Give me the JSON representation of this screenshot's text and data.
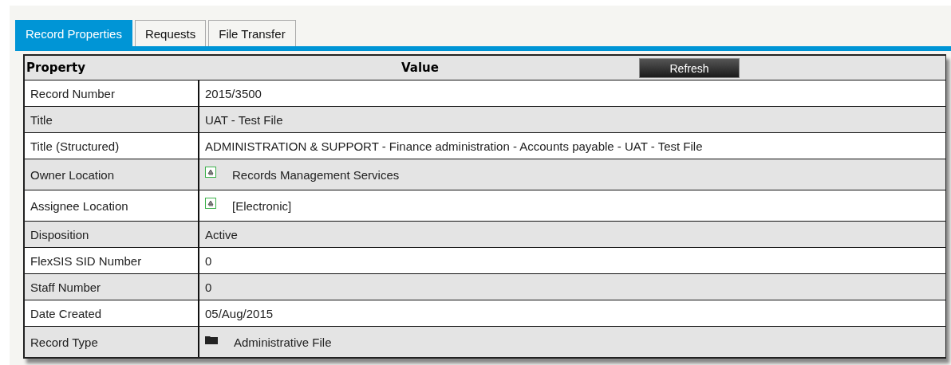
{
  "tabs": [
    {
      "label": "Record Properties",
      "selected": true
    },
    {
      "label": "Requests",
      "selected": false
    },
    {
      "label": "File Transfer",
      "selected": false
    }
  ],
  "table": {
    "columns": [
      "Property",
      "Value"
    ],
    "refresh_button": "Refresh",
    "rows": [
      {
        "property": "Record Number",
        "value": "2015/3500"
      },
      {
        "property": "Title",
        "value": "UAT - Test File"
      },
      {
        "property": "Title (Structured)",
        "value": "ADMINISTRATION & SUPPORT - Finance administration - Accounts payable - UAT - Test File"
      },
      {
        "property": "Owner Location",
        "value": "Records Management Services",
        "kind": "location"
      },
      {
        "property": "Assignee Location",
        "value": "[Electronic]",
        "kind": "location"
      },
      {
        "property": "Disposition",
        "value": "Active"
      },
      {
        "property": "FlexSIS SID Number",
        "value": "0"
      },
      {
        "property": "Staff Number",
        "value": "0"
      },
      {
        "property": "Date Created",
        "value": "05/Aug/2015"
      },
      {
        "property": "Record Type",
        "value": "Administrative File",
        "kind": "folder"
      }
    ]
  }
}
